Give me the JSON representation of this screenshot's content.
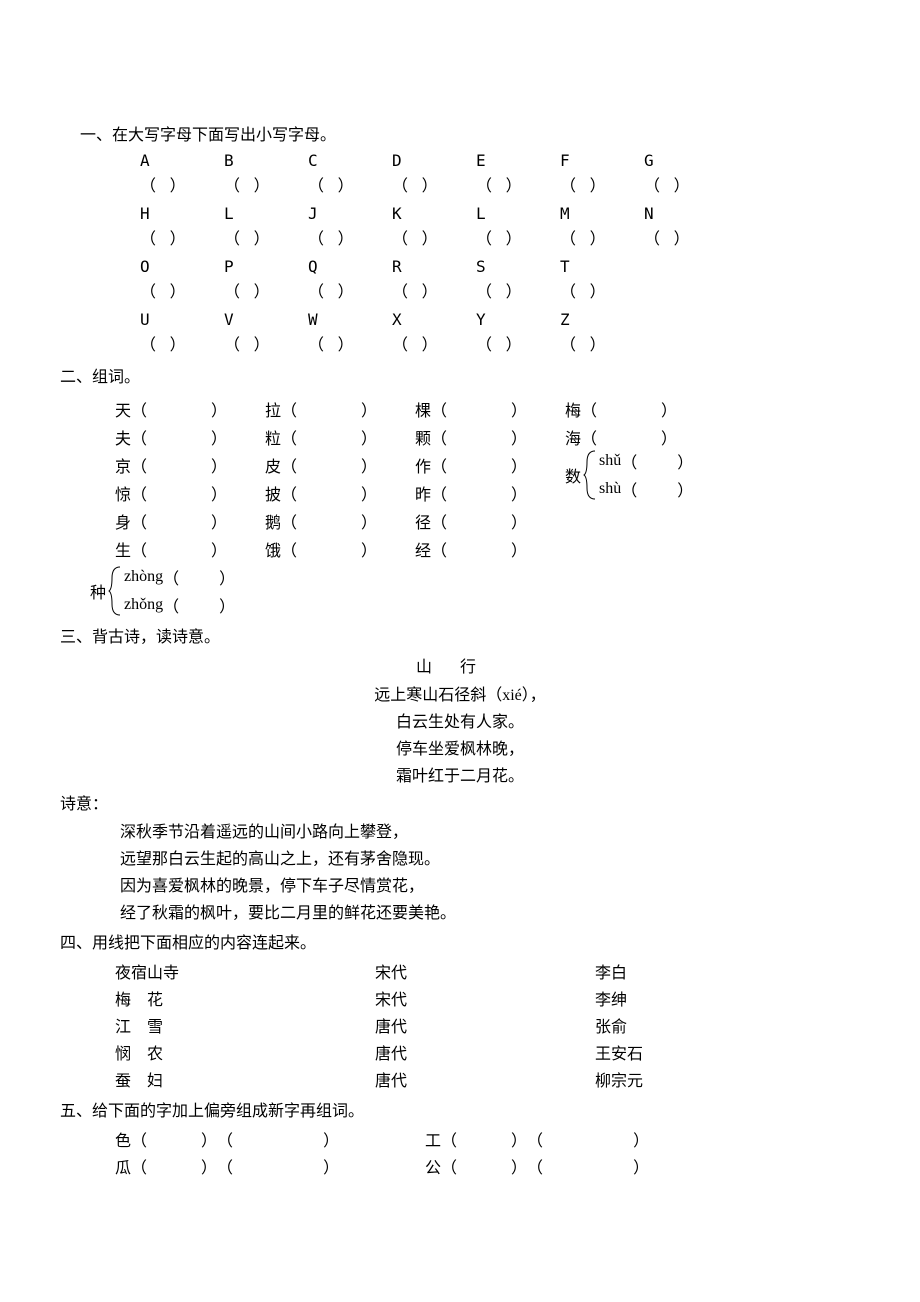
{
  "s1": {
    "title": "一、在大写字母下面写出小写字母。",
    "rows": [
      [
        "A",
        "B",
        "C",
        "D",
        "E",
        "F",
        "G"
      ],
      [
        "H",
        "L",
        "J",
        "K",
        "L",
        "M",
        "N"
      ],
      [
        "O",
        "P",
        "Q",
        "R",
        "S",
        "T"
      ],
      [
        "U",
        "V",
        "W",
        "X",
        "Y",
        "Z"
      ]
    ],
    "bracket": "（  ）"
  },
  "s2": {
    "title": "二、组词。",
    "lp": "（",
    "rp": "）",
    "grid": [
      [
        {
          "c": "天"
        },
        {
          "c": "拉"
        },
        {
          "c": "棵"
        },
        {
          "c": "梅"
        }
      ],
      [
        {
          "c": "夫"
        },
        {
          "c": "粒"
        },
        {
          "c": "颗"
        },
        {
          "c": "海"
        }
      ],
      [
        {
          "c": "京"
        },
        {
          "c": "皮"
        },
        {
          "c": "作"
        },
        null
      ],
      [
        {
          "c": "惊"
        },
        {
          "c": "披"
        },
        {
          "c": "昨"
        },
        null
      ],
      [
        {
          "c": "身"
        },
        {
          "c": "鹅"
        },
        {
          "c": "径"
        },
        null
      ],
      [
        {
          "c": "生"
        },
        {
          "c": "饿"
        },
        {
          "c": "经"
        },
        null
      ]
    ],
    "shu": {
      "char": "数",
      "items": [
        {
          "pinyin": "shǔ"
        },
        {
          "pinyin": "shù"
        }
      ]
    },
    "zhong": {
      "char": "种",
      "items": [
        {
          "pinyin": "zhòng"
        },
        {
          "pinyin": "zhǒng"
        }
      ]
    }
  },
  "s3": {
    "title": "三、背古诗，读诗意。",
    "poem_title": "山行",
    "lines": [
      "远上寒山石径斜（xié），",
      "白云生处有人家。",
      "停车坐爱枫林晚，",
      "霜叶红于二月花。"
    ],
    "shiyi_label": "诗意：",
    "meaning": [
      "深秋季节沿着遥远的山间小路向上攀登，",
      "远望那白云生起的高山之上，还有茅舍隐现。",
      "因为喜爱枫林的晚景，停下车子尽情赏花，",
      "经了秋霜的枫叶，要比二月里的鲜花还要美艳。"
    ]
  },
  "s4": {
    "title": "四、用线把下面相应的内容连起来。",
    "rows": [
      {
        "a": "夜宿山寺",
        "b": "宋代",
        "c": "李白"
      },
      {
        "a": "梅　花",
        "b": "宋代",
        "c": "李绅"
      },
      {
        "a": "江　雪",
        "b": "唐代",
        "c": "张俞"
      },
      {
        "a": "悯　农",
        "b": "唐代",
        "c": "王安石"
      },
      {
        "a": "蚕　妇",
        "b": "唐代",
        "c": "柳宗元"
      }
    ]
  },
  "s5": {
    "title": "五、给下面的字加上偏旁组成新字再组词。",
    "rows": [
      {
        "l": "色",
        "r": "工"
      },
      {
        "l": "瓜",
        "r": "公"
      }
    ],
    "lp": "（",
    "rp": "）"
  }
}
